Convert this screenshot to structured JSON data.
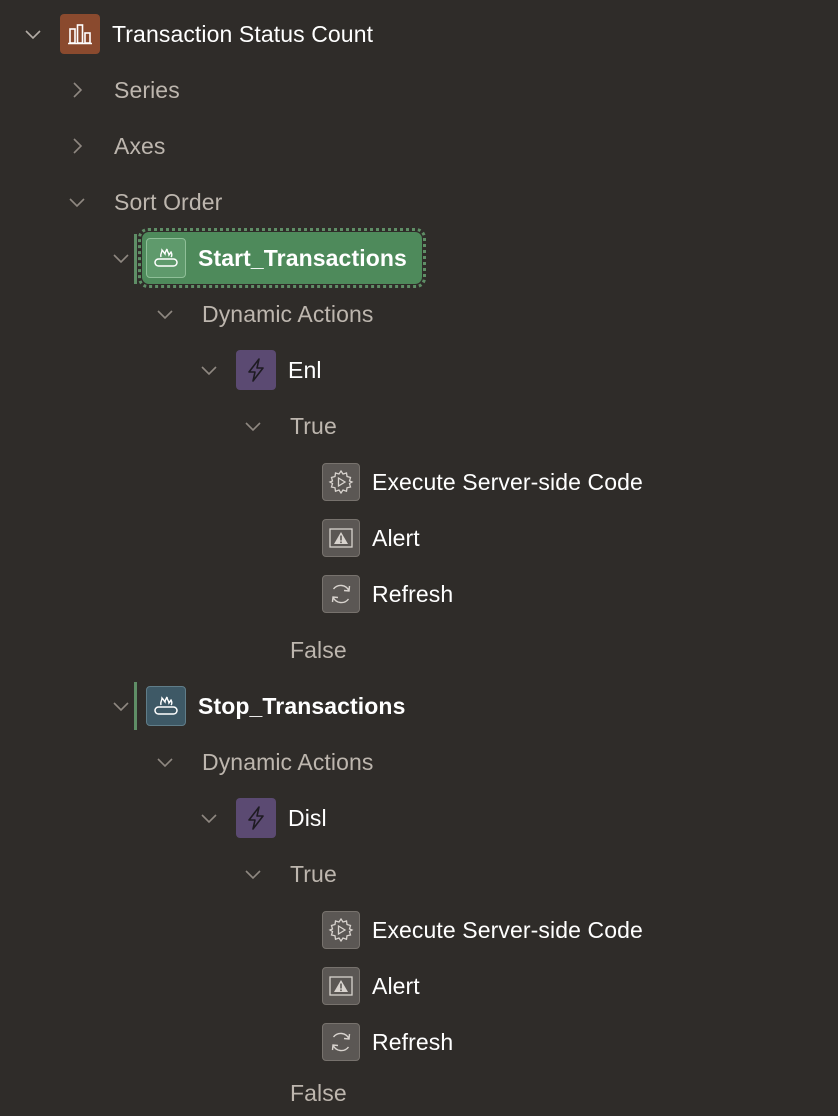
{
  "tree": {
    "root": {
      "label": "Transaction Status Count",
      "icon": "bar-chart-icon",
      "color": "#8a4a2e"
    },
    "series_label": "Series",
    "axes_label": "Axes",
    "sort_order_label": "Sort Order",
    "buttons": [
      {
        "label": "Start_Transactions",
        "icon": "button-region-icon",
        "selected": true,
        "dynamic_actions_label": "Dynamic Actions",
        "da": {
          "label": "Enl",
          "icon": "lightning-icon",
          "true_label": "True",
          "actions": [
            {
              "label": "Execute Server-side Code",
              "icon": "gear-play-icon"
            },
            {
              "label": "Alert",
              "icon": "alert-icon"
            },
            {
              "label": "Refresh",
              "icon": "refresh-icon"
            }
          ],
          "false_label": "False"
        }
      },
      {
        "label": "Stop_Transactions",
        "icon": "button-region-icon",
        "selected": false,
        "dynamic_actions_label": "Dynamic Actions",
        "da": {
          "label": "Disl",
          "icon": "lightning-icon",
          "true_label": "True",
          "actions": [
            {
              "label": "Execute Server-side Code",
              "icon": "gear-play-icon"
            },
            {
              "label": "Alert",
              "icon": "alert-icon"
            },
            {
              "label": "Refresh",
              "icon": "refresh-icon"
            }
          ],
          "false_label": "False"
        }
      }
    ]
  },
  "colors": {
    "background": "#2f2c29",
    "selected": "#4e8a5b",
    "dynamic_action": "#5b4a72",
    "chart": "#8a4a2e"
  }
}
